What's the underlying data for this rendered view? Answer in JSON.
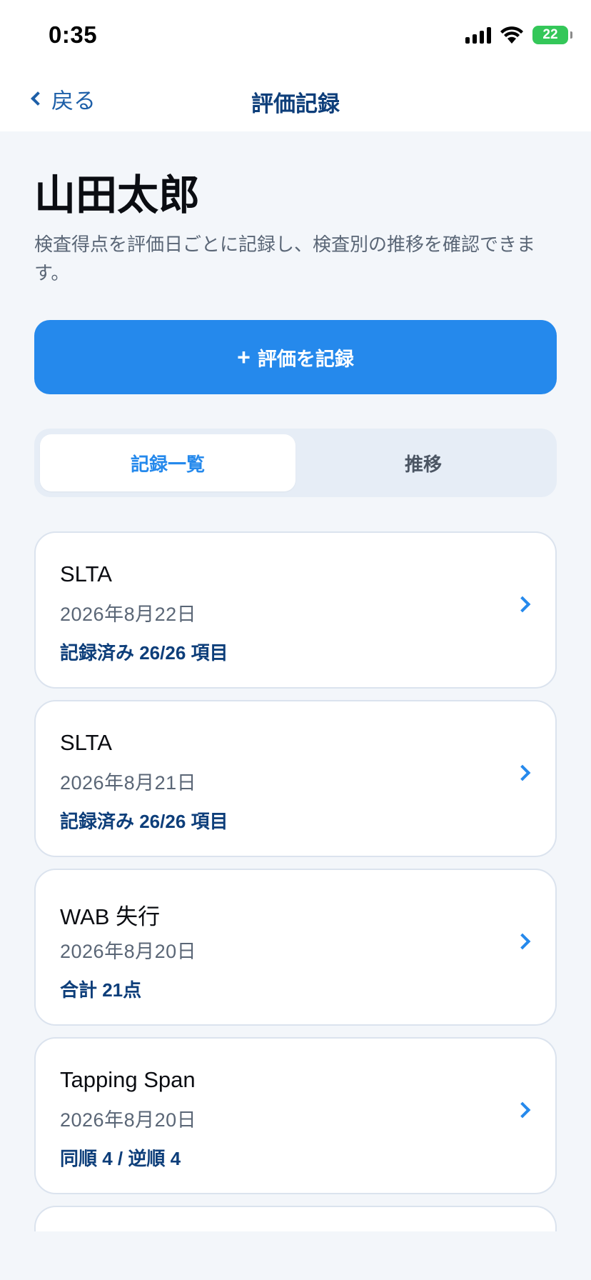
{
  "status_bar": {
    "time": "0:35",
    "battery": "22",
    "icons": [
      "cellular-signal-icon",
      "wifi-icon",
      "battery-charging-icon"
    ]
  },
  "nav": {
    "back_label": "戻る",
    "title": "評価記録"
  },
  "patient": {
    "name": "山田太郎",
    "description": "検査得点を評価日ごとに記録し、検査別の推移を確認できます。"
  },
  "record_button": {
    "icon": "plus-icon",
    "label": "評価を記録"
  },
  "tabs": [
    {
      "label": "記録一覧",
      "active": true
    },
    {
      "label": "推移",
      "active": false
    }
  ],
  "records": [
    {
      "title": "SLTA",
      "date": "2026年8月22日",
      "summary": "記録済み 26/26 項目"
    },
    {
      "title": "SLTA",
      "date": "2026年8月21日",
      "summary": "記録済み 26/26 項目"
    },
    {
      "title": "WAB 失行",
      "date": "2026年8月20日",
      "summary": "合計 21点"
    },
    {
      "title": "Tapping Span",
      "date": "2026年8月20日",
      "summary": "同順 4 / 逆順 4"
    }
  ],
  "colors": {
    "accent": "#2589ec",
    "nav_title": "#0d3e7a",
    "background": "#f3f6fa",
    "battery": "#34c759"
  }
}
